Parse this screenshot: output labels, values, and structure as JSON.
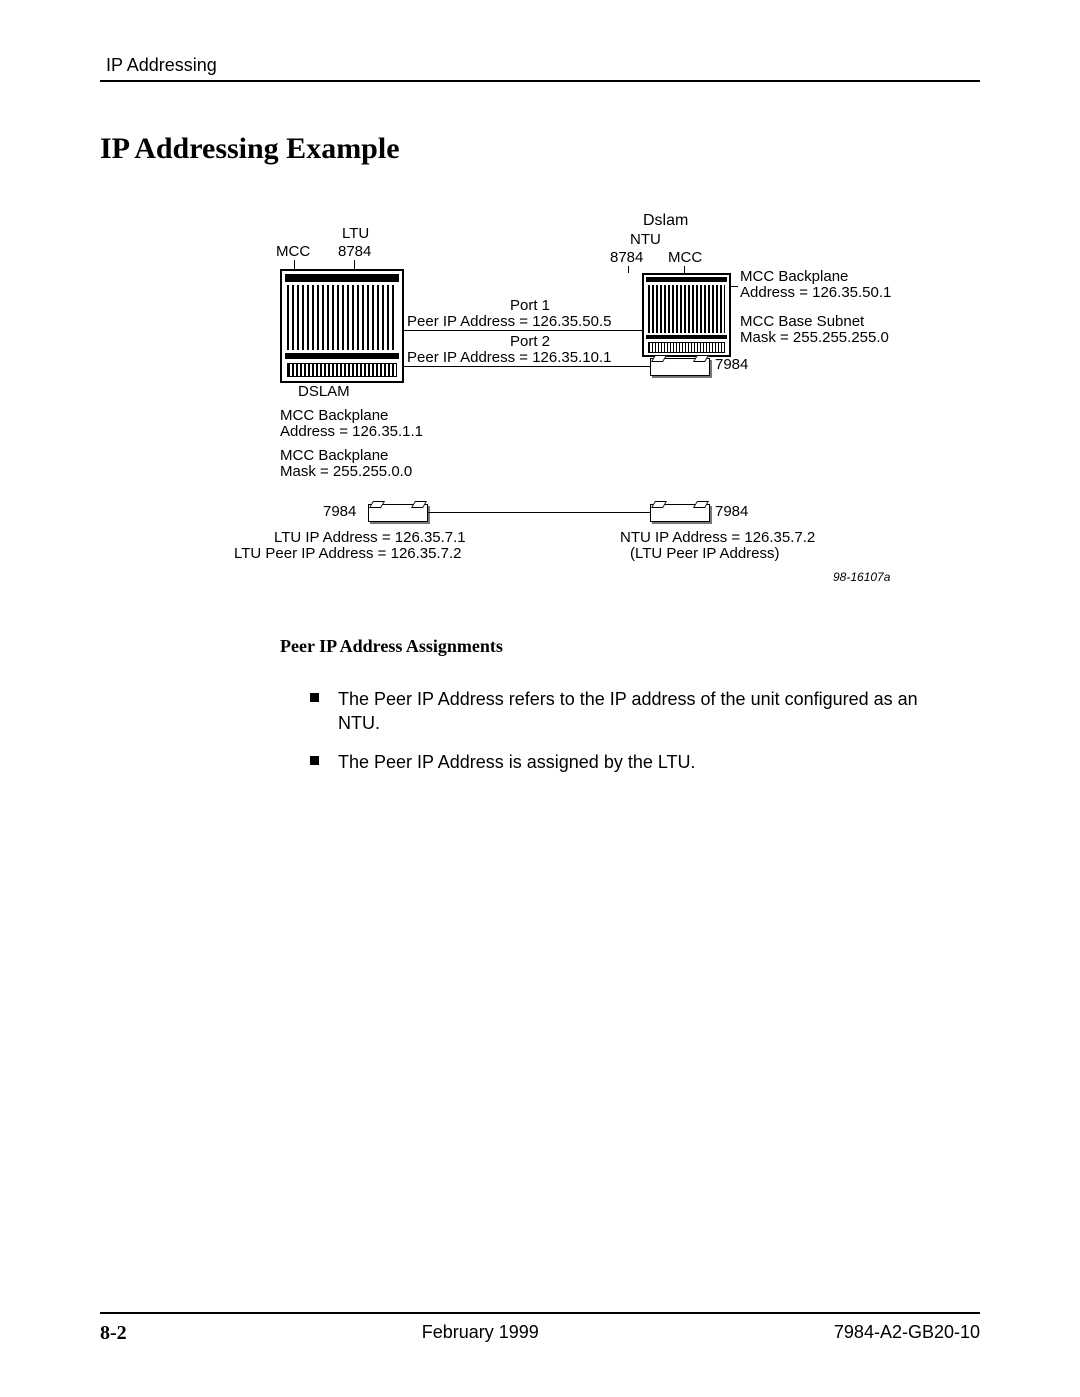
{
  "header": {
    "section": "IP Addressing"
  },
  "title": "IP Addressing Example",
  "diagram": {
    "ltu_group": "LTU",
    "ltu_model": "8784",
    "mcc_left": "MCC",
    "dslam_left": "DSLAM",
    "port1_label": "Port 1",
    "port1_peer": "Peer IP Address = 126.35.50.5",
    "port2_label": "Port 2",
    "port2_peer": "Peer IP Address = 126.35.10.1",
    "dslam_right": "Dslam",
    "ntu_group": "NTU",
    "ntu_model": "8784",
    "mcc_right": "MCC",
    "mcc_backplane_addr_label": "MCC Backplane",
    "mcc_backplane_addr_value": "Address = 126.35.50.1",
    "mcc_base_subnet_label": "MCC Base Subnet",
    "mcc_base_subnet_value": "Mask = 255.255.255.0",
    "right_7984": "7984",
    "left_backplane_addr_label": "MCC Backplane",
    "left_backplane_addr_value": "Address = 126.35.1.1",
    "left_backplane_mask_label": "MCC Backplane",
    "left_backplane_mask_value": "Mask = 255.255.0.0",
    "left_7984": "7984",
    "mid_7984_right": "7984",
    "ltu_ip": "LTU IP Address = 126.35.7.1",
    "ltu_peer": "LTU Peer IP Address = 126.35.7.2",
    "ntu_ip": "NTU IP Address = 126.35.7.2",
    "ntu_peer_note": "(LTU Peer IP Address)",
    "figref": "98-16107a"
  },
  "subsection": "Peer IP Address Assignments",
  "bullets": [
    "The Peer IP Address refers to the IP address of the unit configured as an NTU.",
    "The Peer IP Address is assigned by the LTU."
  ],
  "footer": {
    "page": "8-2",
    "date": "February 1999",
    "doc": "7984-A2-GB20-10"
  }
}
